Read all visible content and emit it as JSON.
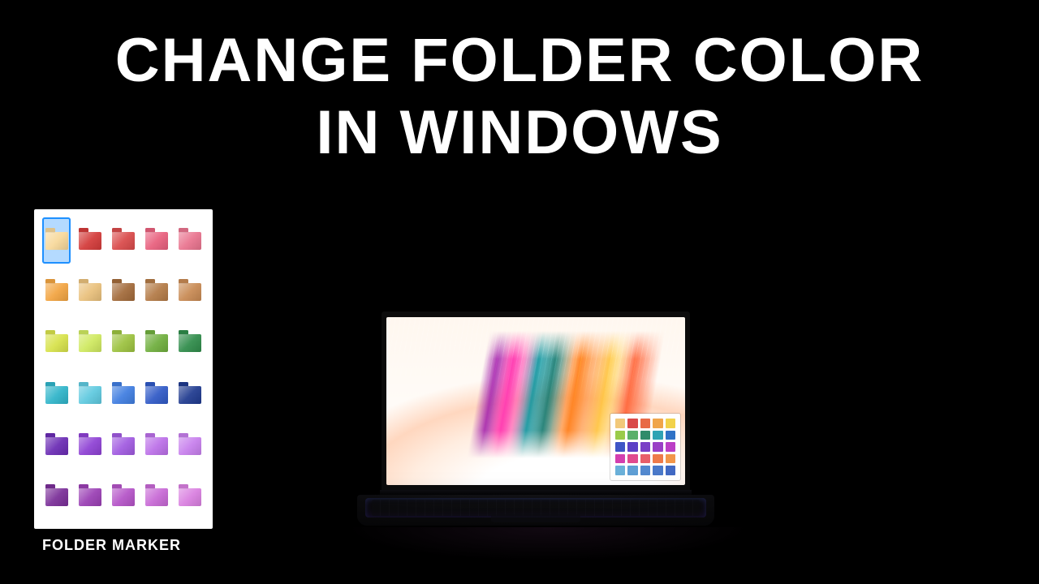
{
  "headline": {
    "line1": "CHANGE FOLDER COLOR",
    "line2": "IN WINDOWS"
  },
  "palette": {
    "caption": "FOLDER MARKER",
    "selectedIndex": 0,
    "colors": [
      "#f7d89a",
      "#d33a39",
      "#d94a4a",
      "#e85f7d",
      "#e9738e",
      "#f2a441",
      "#e9c07b",
      "#a26a3a",
      "#b37a46",
      "#c88a53",
      "#d7e24a",
      "#cfe95f",
      "#9cc23f",
      "#6fae3d",
      "#2f8c4a",
      "#2fb4c9",
      "#5ec9df",
      "#3f7de0",
      "#2f59c6",
      "#1f3a8f",
      "#6a2bb4",
      "#8e41d4",
      "#a05ae0",
      "#bb6fe8",
      "#c77fed",
      "#7a2e98",
      "#9a3fb4",
      "#b453c7",
      "#c768d5",
      "#d97fe0"
    ]
  },
  "laptop": {
    "miniPalette": [
      "#f2c97a",
      "#d94a4a",
      "#e86a45",
      "#f0a54a",
      "#f2d24a",
      "#9acb4a",
      "#5bb06a",
      "#2f8c6a",
      "#2fa3b4",
      "#2f72c6",
      "#3f55c6",
      "#5c3fc6",
      "#7a3fc6",
      "#9a3fc6",
      "#bb3fc6",
      "#d33faf",
      "#e04a8e",
      "#e85f6a",
      "#ee7a4a",
      "#f2964a",
      "#6ab0d9",
      "#5e9ed4",
      "#5389cf",
      "#4a79c9",
      "#4169c3"
    ]
  }
}
